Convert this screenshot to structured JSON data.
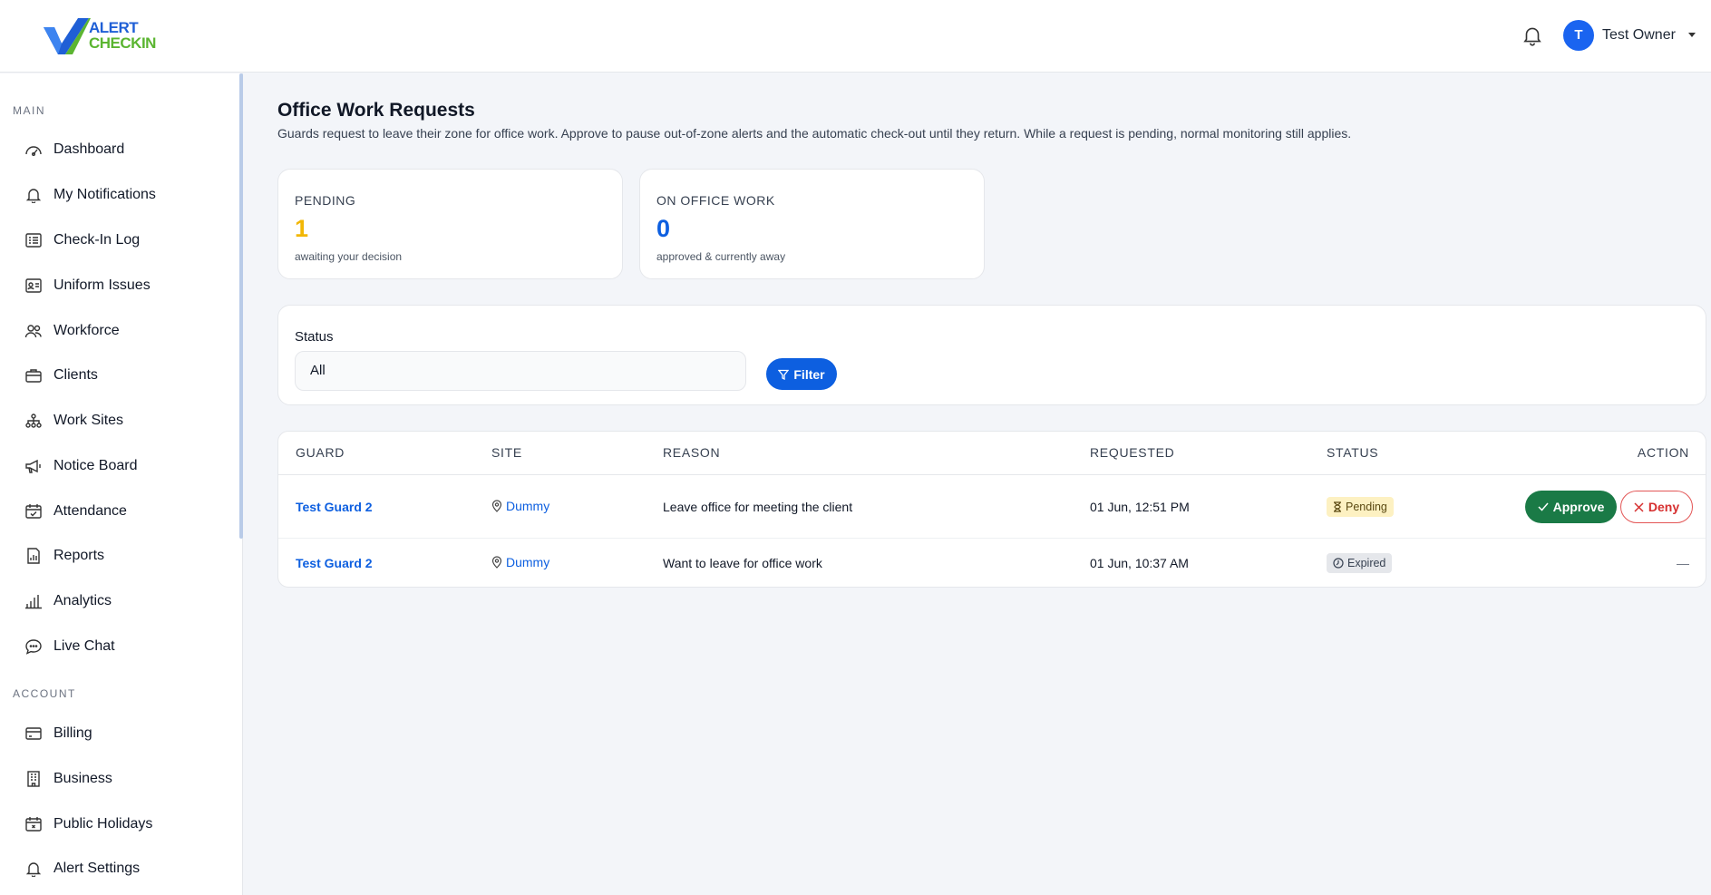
{
  "brand": {
    "line1": "ALERT",
    "line2": "CHECKIN"
  },
  "topbar": {
    "user_initial": "T",
    "user_name": "Test Owner"
  },
  "sidebar": {
    "section_main": "MAIN",
    "section_account": "ACCOUNT",
    "main_items": [
      {
        "label": "Dashboard",
        "icon": "dashboard-icon"
      },
      {
        "label": "My Notifications",
        "icon": "bell-icon"
      },
      {
        "label": "Check-In Log",
        "icon": "list-icon"
      },
      {
        "label": "Uniform Issues",
        "icon": "id-card-icon"
      },
      {
        "label": "Workforce",
        "icon": "people-icon"
      },
      {
        "label": "Clients",
        "icon": "briefcase-icon"
      },
      {
        "label": "Work Sites",
        "icon": "sitemap-icon"
      },
      {
        "label": "Notice Board",
        "icon": "megaphone-icon"
      },
      {
        "label": "Attendance",
        "icon": "calendar-check-icon"
      },
      {
        "label": "Reports",
        "icon": "report-icon"
      },
      {
        "label": "Analytics",
        "icon": "bar-chart-icon"
      },
      {
        "label": "Live Chat",
        "icon": "chat-icon"
      }
    ],
    "account_items": [
      {
        "label": "Billing",
        "icon": "credit-card-icon"
      },
      {
        "label": "Business",
        "icon": "building-icon"
      },
      {
        "label": "Public Holidays",
        "icon": "calendar-x-icon"
      },
      {
        "label": "Alert Settings",
        "icon": "bell-icon"
      }
    ]
  },
  "page": {
    "title": "Office Work Requests",
    "subtitle": "Guards request to leave their zone for office work. Approve to pause out-of-zone alerts and the automatic check-out until they return. While a request is pending, normal monitoring still applies."
  },
  "stats": [
    {
      "label": "PENDING",
      "value": "1",
      "note": "awaiting your decision",
      "color": "#f2b705"
    },
    {
      "label": "ON OFFICE WORK",
      "value": "0",
      "note": "approved & currently away",
      "color": "#0d5fe0"
    }
  ],
  "filter": {
    "label": "Status",
    "selected": "All",
    "button": "Filter"
  },
  "table": {
    "headers": [
      "GUARD",
      "SITE",
      "REASON",
      "REQUESTED",
      "STATUS",
      "ACTION"
    ],
    "rows": [
      {
        "guard": "Test Guard 2",
        "site": "Dummy",
        "reason": "Leave office for meeting the client",
        "requested": "01 Jun, 12:51 PM",
        "status": "Pending",
        "approve": "Approve",
        "deny": "Deny"
      },
      {
        "guard": "Test Guard 2",
        "site": "Dummy",
        "reason": "Want to leave for office work",
        "requested": "01 Jun, 10:37 AM",
        "status": "Expired",
        "action_placeholder": "—"
      }
    ]
  },
  "colors": {
    "primary": "#0d5fe0",
    "approve": "#1a7a46",
    "deny": "#d62f2f",
    "pending": "#f2b705"
  }
}
